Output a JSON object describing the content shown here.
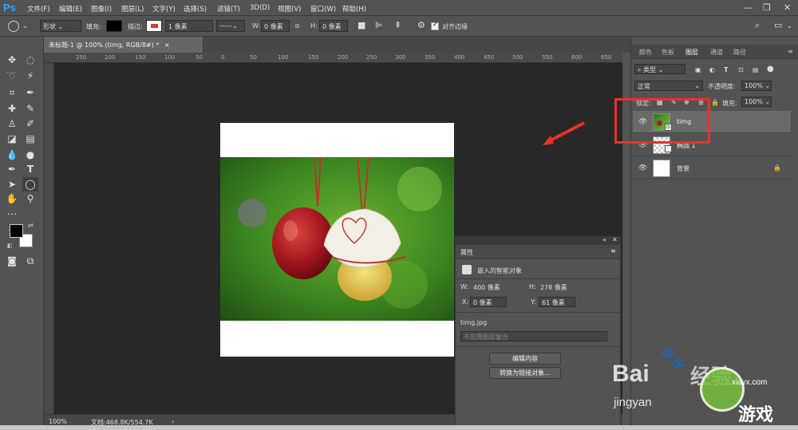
{
  "app": {
    "logo": "Ps"
  },
  "menu": [
    "文件(F)",
    "编辑(E)",
    "图像(I)",
    "图层(L)",
    "文字(Y)",
    "选择(S)",
    "滤镜(T)",
    "3D(D)",
    "视图(V)",
    "窗口(W)",
    "帮助(H)"
  ],
  "window_controls": {
    "minimize": "—",
    "restore": "❐",
    "close": "✕"
  },
  "options": {
    "tool_mode": "形状",
    "fill_label": "填充:",
    "stroke_label": "描边:",
    "stroke_width": "1 像素",
    "w_label": "W:",
    "w_value": "0 像素",
    "h_label": "H:",
    "h_value": "0 像素",
    "align_edges": "对齐边缘"
  },
  "document": {
    "tab_title": "未标题-1 @ 100% (timg, RGB/8#) *",
    "tab_close": "×",
    "ruler_marks": [
      "250",
      "200",
      "150",
      "100",
      "50",
      "0",
      "50",
      "100",
      "150",
      "200",
      "250",
      "300",
      "350",
      "400",
      "450",
      "500",
      "550",
      "600",
      "650"
    ]
  },
  "status": {
    "zoom": "100%",
    "doc_info": "文档:468.8K/554.7K"
  },
  "properties": {
    "title": "属性",
    "type": "嵌入的智能对象",
    "w_label": "W:",
    "w_value": "400 像素",
    "h_label": "H:",
    "h_value": "278 像素",
    "x_label": "X:",
    "x_value": "0 像素",
    "y_label": "Y:",
    "y_value": "61 像素",
    "filename": "timg.jpg",
    "comp_placeholder": "不应用图层复合",
    "edit_button": "编辑内容",
    "convert_button": "转换为链接对象..."
  },
  "panel": {
    "tabs": [
      "颜色",
      "色板",
      "图层",
      "通道",
      "路径"
    ],
    "active_tab": "图层",
    "filter": "类型",
    "blend_mode": "正常",
    "opacity_label": "不透明度:",
    "opacity_value": "100%",
    "lock_label": "锁定:",
    "fill_label": "填充:",
    "fill_value": "100%",
    "layers": [
      {
        "name": "timg"
      },
      {
        "name": "椭圆 1"
      },
      {
        "name": "背景"
      }
    ]
  },
  "watermark": {
    "brand": "Bai",
    "brand2": "经验",
    "sub": "jingyan",
    "site": "xiayx.com",
    "game": "游戏"
  },
  "colors": {
    "accent_ps": "#31a8ff",
    "highlight": "#e6332a"
  }
}
